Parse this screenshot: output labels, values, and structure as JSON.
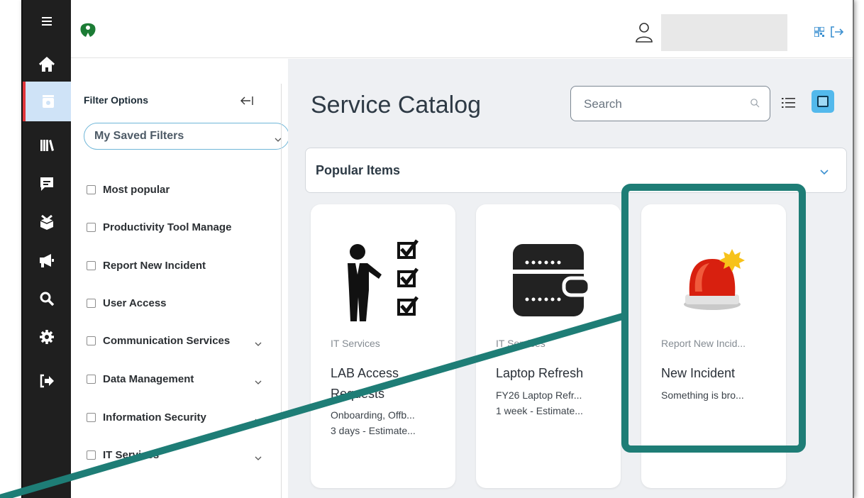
{
  "colors": {
    "rail_bg": "#1f1f1f",
    "rail_active": "#cfe3f7",
    "rail_active_marker": "#e0353b",
    "accent": "#53b9ec",
    "annotation": "#1e7d76"
  },
  "rail": {
    "items": [
      {
        "icon": "hamburger-menu-icon"
      },
      {
        "icon": "home-icon"
      },
      {
        "icon": "service-catalog-icon",
        "active": true
      },
      {
        "icon": "knowledge-library-icon"
      },
      {
        "icon": "chat-message-icon"
      },
      {
        "icon": "box-requests-icon"
      },
      {
        "icon": "announcement-megaphone-icon"
      },
      {
        "icon": "search-icon"
      },
      {
        "icon": "settings-gear-icon"
      },
      {
        "icon": "logout-icon"
      }
    ]
  },
  "topbar": {
    "logo_icon": "brand-logo-icon",
    "user_icon": "user-icon",
    "qr_icon": "qr-code-icon",
    "logout_icon": "logout-icon"
  },
  "filters": {
    "title": "Filter Options",
    "saved_filters": "My Saved Filters",
    "items": [
      {
        "label": "Most popular",
        "has_children": false
      },
      {
        "label": "Productivity Tool Manage",
        "has_children": false
      },
      {
        "label": "Report New Incident",
        "has_children": false
      },
      {
        "label": "User Access",
        "has_children": false
      },
      {
        "label": "Communication Services",
        "has_children": true
      },
      {
        "label": "Data Management",
        "has_children": true
      },
      {
        "label": "Information Security",
        "has_children": true
      },
      {
        "label": "IT Services",
        "has_children": true
      }
    ]
  },
  "main": {
    "title": "Service Catalog",
    "search_placeholder": "Search",
    "popular_title": "Popular Items"
  },
  "cards": [
    {
      "image_icon": "presenter-checklist-icon",
      "category": "IT Services",
      "title": "LAB Access Requests",
      "desc1": "Onboarding, Offb...",
      "desc2": "3 days - Estimate..."
    },
    {
      "image_icon": "wallet-laptop-icon",
      "category": "IT Services",
      "title": "Laptop Refresh",
      "desc1": "FY26 Laptop Refr...",
      "desc2": "1 week - Estimate..."
    },
    {
      "image_icon": "alarm-siren-icon",
      "category": "Report New Incid...",
      "title": "New Incident",
      "desc1": "Something is bro...",
      "desc2": ""
    }
  ]
}
